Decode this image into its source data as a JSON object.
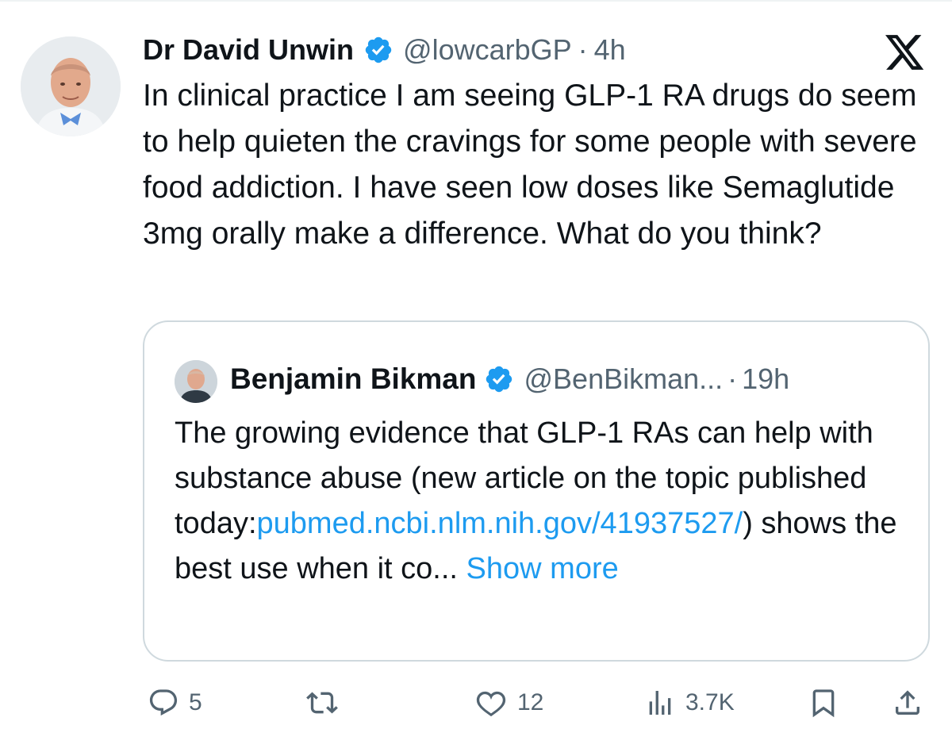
{
  "tweet": {
    "author_name": "Dr David Unwin",
    "handle": "@lowcarbGP",
    "separator": "·",
    "time": "4h",
    "text": "In clinical practice I am seeing GLP-1 RA drugs do seem to help quieten the cravings for some people with severe food addiction. I have seen low doses like Semaglutide 3mg orally make a difference. What do you think?"
  },
  "quote": {
    "author_name": "Benjamin Bikman",
    "handle": "@BenBikman...",
    "separator": "·",
    "time": "19h",
    "text_before_link": "The growing evidence that GLP-1 RAs can help with substance abuse (new article on the topic published today:",
    "link_text": "pubmed.ncbi.nlm.nih.gov/41937527/",
    "text_after_link": ") shows the best use when it co...",
    "show_more": "Show more"
  },
  "actions": {
    "replies": "5",
    "reposts": "",
    "likes": "12",
    "views": "3.7K"
  },
  "icons": {
    "reply": "reply-icon",
    "repost": "repost-icon",
    "like": "heart-icon",
    "views": "views-chart-icon",
    "bookmark": "bookmark-icon",
    "share": "share-icon",
    "verified": "verified-badge-icon",
    "brand": "x-logo-icon"
  },
  "colors": {
    "text": "#0f1419",
    "secondary": "#536471",
    "link": "#1d9bf0",
    "verified": "#1d9bf0",
    "border": "#cfd9de"
  }
}
